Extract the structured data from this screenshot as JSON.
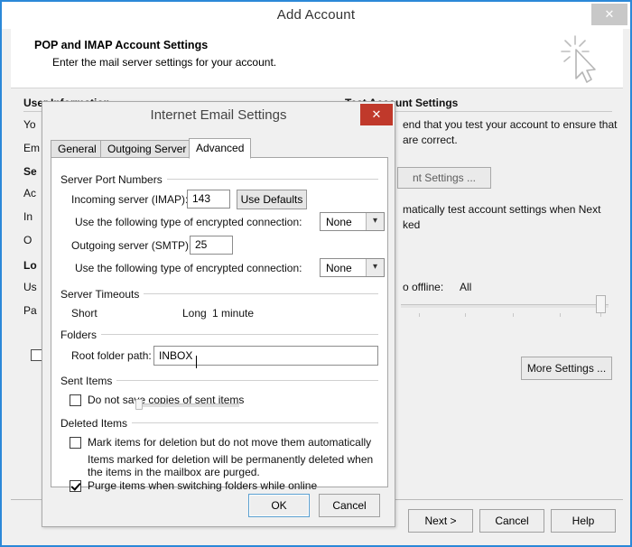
{
  "window": {
    "title": "Add Account",
    "close_label": "✕",
    "banner": {
      "title": "POP and IMAP Account Settings",
      "subtitle": "Enter the mail server settings for your account.",
      "icon": "click-cursor-icon"
    },
    "background": {
      "user_information": "User Information",
      "labels": [
        "Yo",
        "Em",
        "Se",
        "Ac",
        "In",
        "O",
        "Lo",
        "Us",
        "Pa"
      ],
      "test_account_settings": "Test Account Settings",
      "test_desc_line1": "end that you test your account to ensure that",
      "test_desc_line2": "are correct.",
      "test_button": "nt Settings ...",
      "auto_test_line1": "matically test account settings when Next",
      "auto_test_line2": "ked",
      "mail_offline_label": "o offline:",
      "mail_offline_value": "All",
      "more_settings_button": "More Settings ..."
    },
    "footer": {
      "next": "Next >",
      "cancel": "Cancel",
      "help": "Help"
    }
  },
  "dialog": {
    "title": "Internet Email Settings",
    "close_label": "✕",
    "tabs": [
      {
        "label": "General",
        "active": false
      },
      {
        "label": "Outgoing Server",
        "active": false
      },
      {
        "label": "Advanced",
        "active": true
      }
    ],
    "groups": {
      "server_port_numbers": "Server Port Numbers",
      "server_timeouts": "Server Timeouts",
      "folders": "Folders",
      "sent_items": "Sent Items",
      "deleted_items": "Deleted Items"
    },
    "fields": {
      "incoming_label": "Incoming server (IMAP):",
      "incoming_value": "143",
      "use_defaults_button": "Use Defaults",
      "incoming_encryption_label": "Use the following type of encrypted connection:",
      "incoming_encryption_value": "None",
      "outgoing_label": "Outgoing server (SMTP):",
      "outgoing_value": "25",
      "outgoing_encryption_label": "Use the following type of encrypted connection:",
      "outgoing_encryption_value": "None",
      "timeout_short": "Short",
      "timeout_long": "Long",
      "timeout_value": "1 minute",
      "root_folder_label": "Root folder path:",
      "root_folder_value": "INBOX"
    },
    "checkboxes": {
      "do_not_save_sent": {
        "label": "Do not save copies of sent items",
        "checked": false
      },
      "mark_for_deletion": {
        "label": "Mark items for deletion but do not move them automatically",
        "checked": false
      },
      "mark_help_line1": "Items marked for deletion will be permanently deleted when",
      "mark_help_line2": "the items in the mailbox are purged.",
      "purge_on_switch": {
        "label": "Purge items when switching folders while online",
        "checked": true
      }
    },
    "buttons": {
      "ok": "OK",
      "cancel": "Cancel"
    }
  },
  "colors": {
    "window_border": "#2b88d8",
    "dialog_close_red": "#c0392b",
    "focus_blue": "#5ba0d0"
  }
}
